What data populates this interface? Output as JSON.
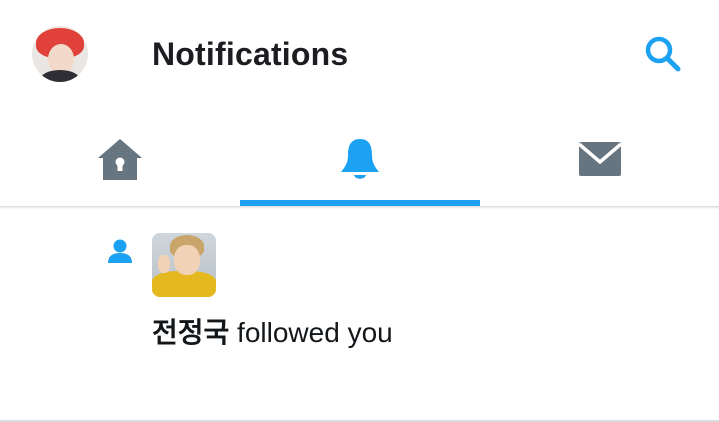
{
  "header": {
    "title": "Notifications",
    "avatar_icon": "user-avatar",
    "search_icon": "search-icon"
  },
  "tabs": [
    {
      "name": "home",
      "icon": "home-icon",
      "active": false
    },
    {
      "name": "notifications",
      "icon": "bell-icon",
      "active": true
    },
    {
      "name": "messages",
      "icon": "envelope-icon",
      "active": false
    }
  ],
  "notifications": [
    {
      "type_icon": "follow-person-icon",
      "user_name": "전정국",
      "action_text": " followed you"
    }
  ],
  "colors": {
    "accent": "#1da1f2",
    "icon_inactive": "#667580",
    "text": "#14171a"
  }
}
